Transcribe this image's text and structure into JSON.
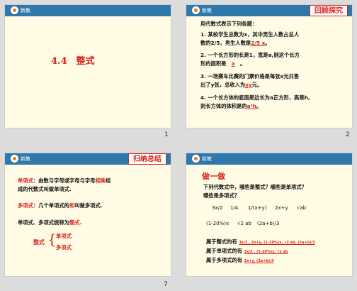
{
  "slides": [
    {
      "logo": "新教",
      "title": "4.4　整式",
      "page": "1"
    },
    {
      "logo": "新教",
      "tag": "回顾探究",
      "page": "2",
      "intro": "用代数式表示下列各题：",
      "q1a": "1. 某校学生总数为x，其中男生人数占总人",
      "q1b": "数的",
      "q1frac": "2/5",
      "q1c": "，男生人数是",
      "q1ans": "2/5 x",
      "q1d": "。",
      "q2": "2. 一个长方形的长是1，宽是a,则这个长方",
      "q2b": "形的面积是",
      "q2ans": "a",
      "q2c": "。",
      "q3": "3. 一场赛车比赛的门票价格是每张x元共售",
      "q3b": "出了y张，总收入为",
      "q3ans": "xy",
      "q3c": "元。",
      "q4": "4. 一个长方体的底面是边长为a正方形，高是h,",
      "q4b": "则长方体的体积是的",
      "q4ans": "a²h",
      "q4c": "。"
    },
    {
      "logo": "新教",
      "tag": "归纳总结",
      "page": "7",
      "p1_label": "单项式",
      "p1_text_a": "：由数与字母或字母与字母",
      "p1_hl": "相乘",
      "p1_text_b": "组",
      "p1_line2": "成的代数式叫做单项式.",
      "p2_label": "多项式",
      "p2_text_a": "：几个单项式的",
      "p2_hl": "和",
      "p2_text_b": "叫做多项式.",
      "p3_text": "单项式、多项式统称为",
      "p3_hl": "整式",
      "p3_end": ".",
      "tree_root": "整式",
      "tree_a": "单项式",
      "tree_b": "多项式"
    },
    {
      "logo": "新教",
      "heading": "做一做",
      "q_a": "下列代数式中，哪些是整式？哪些是单项式？",
      "q_b": "哪些是多项式？",
      "expr1": "3x/2",
      "expr2": "1/4",
      "expr3": "1/(x+y)",
      "expr4": "2x+y",
      "expr5": "√ab",
      "expr6": "(1-20%)x",
      "expr7": "√2 ab",
      "expr8": "(2a+b)/3",
      "ans1_label": "属于整式的有",
      "ans1": "3x/2 , 2x+y, (1-20%)x, √2 ab, (2a+b)/3",
      "ans2_label": "属于单项式的有",
      "ans2": "3x/2 , (1-20%)x, √2 ab",
      "ans3_label": "属于多项式的有",
      "ans3": "2x+y, (2a+b)/3"
    }
  ]
}
